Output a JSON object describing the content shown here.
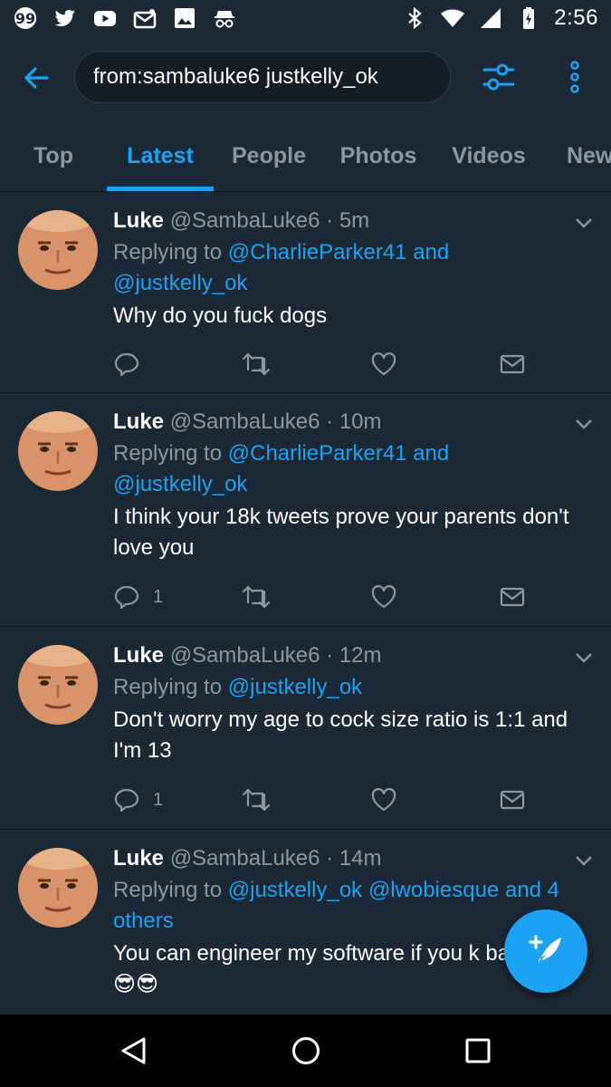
{
  "status_bar": {
    "time": "2:56",
    "left_icons": [
      "quote-notification-icon",
      "twitter-icon",
      "youtube-icon",
      "mail-icon",
      "photos-icon",
      "incognito-icon"
    ],
    "right_icons": [
      "bluetooth-icon",
      "wifi-icon",
      "signal-icon",
      "battery-charging-icon"
    ]
  },
  "app_bar": {
    "search_value": "from:sambaluke6 justkelly_ok"
  },
  "tabs": [
    {
      "label": "Top",
      "active": false
    },
    {
      "label": "Latest",
      "active": true
    },
    {
      "label": "People",
      "active": false
    },
    {
      "label": "Photos",
      "active": false
    },
    {
      "label": "Videos",
      "active": false
    },
    {
      "label": "New",
      "active": false
    }
  ],
  "tweets": [
    {
      "name": "Luke",
      "handle": "@SambaLuke6",
      "dot": "·",
      "time": "5m",
      "reply_prefix": "Replying to",
      "mentions": "@CharlieParker41 and @justkelly_ok",
      "text": "Why do you fuck dogs",
      "reply_count": ""
    },
    {
      "name": "Luke",
      "handle": "@SambaLuke6",
      "dot": "·",
      "time": "10m",
      "reply_prefix": "Replying to",
      "mentions": "@CharlieParker41 and @justkelly_ok",
      "text": "I think your 18k tweets prove your parents don't love you",
      "reply_count": "1"
    },
    {
      "name": "Luke",
      "handle": "@SambaLuke6",
      "dot": "·",
      "time": "12m",
      "reply_prefix": "Replying to",
      "mentions": "@justkelly_ok",
      "text": "Don't worry my age to cock size ratio is 1:1 and I'm 13",
      "reply_count": "1"
    },
    {
      "name": "Luke",
      "handle": "@SambaLuke6",
      "dot": "·",
      "time": "14m",
      "reply_prefix": "Replying to",
      "mentions": "@justkelly_ok @lwobiesque and 4 others",
      "text": "You can engineer my software if you k babe 😎😎😎",
      "reply_count": ""
    }
  ],
  "colors": {
    "accent": "#1da1f2",
    "background": "#1b2836",
    "secondary_text": "#8899a6"
  },
  "fab": {
    "icon": "compose-tweet-icon"
  },
  "nav_bar": {
    "icons": [
      "back-triangle-icon",
      "home-circle-icon",
      "recents-square-icon"
    ]
  }
}
